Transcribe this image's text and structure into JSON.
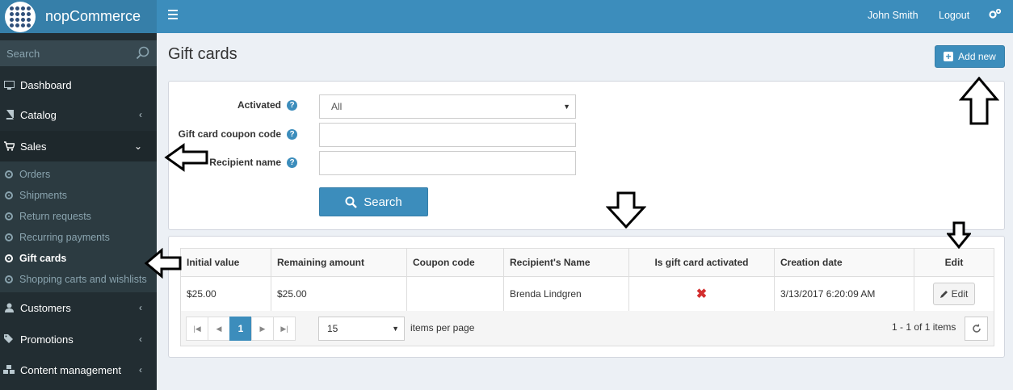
{
  "app": {
    "brand": "nopCommerce"
  },
  "sidebar": {
    "search_placeholder": "Search",
    "items": [
      {
        "label": "Dashboard",
        "icon": "desktop-icon"
      },
      {
        "label": "Catalog",
        "icon": "book-icon"
      },
      {
        "label": "Sales",
        "icon": "cart-icon"
      },
      {
        "label": "Customers",
        "icon": "user-icon"
      },
      {
        "label": "Promotions",
        "icon": "tags-icon"
      },
      {
        "label": "Content management",
        "icon": "cubes-icon"
      }
    ],
    "sales_sub": [
      {
        "label": "Orders"
      },
      {
        "label": "Shipments"
      },
      {
        "label": "Return requests"
      },
      {
        "label": "Recurring payments"
      },
      {
        "label": "Gift cards"
      },
      {
        "label": "Shopping carts and wishlists"
      }
    ]
  },
  "header": {
    "user": "John Smith",
    "logout": "Logout"
  },
  "page": {
    "title": "Gift cards",
    "add_new": "Add new"
  },
  "search_form": {
    "activated_label": "Activated",
    "activated_value": "All",
    "coupon_label": "Gift card coupon code",
    "coupon_value": "",
    "recipient_label": "Recipient name",
    "recipient_value": "",
    "search_button": "Search"
  },
  "grid": {
    "columns": [
      "Initial value",
      "Remaining amount",
      "Coupon code",
      "Recipient's Name",
      "Is gift card activated",
      "Creation date",
      "Edit"
    ],
    "rows": [
      {
        "initial": "$25.00",
        "remaining": "$25.00",
        "coupon": "",
        "recipient": "Brenda Lindgren",
        "activated": "✖",
        "created": "3/13/2017 6:20:09 AM",
        "edit": "Edit"
      }
    ],
    "pager": {
      "current": "1",
      "page_size": "15",
      "items_per_page": "items per page",
      "range": "1 - 1 of 1 items"
    }
  },
  "colors": {
    "primary": "#3c8dbc",
    "sidebar": "#222d32",
    "danger": "#d32f2f"
  }
}
